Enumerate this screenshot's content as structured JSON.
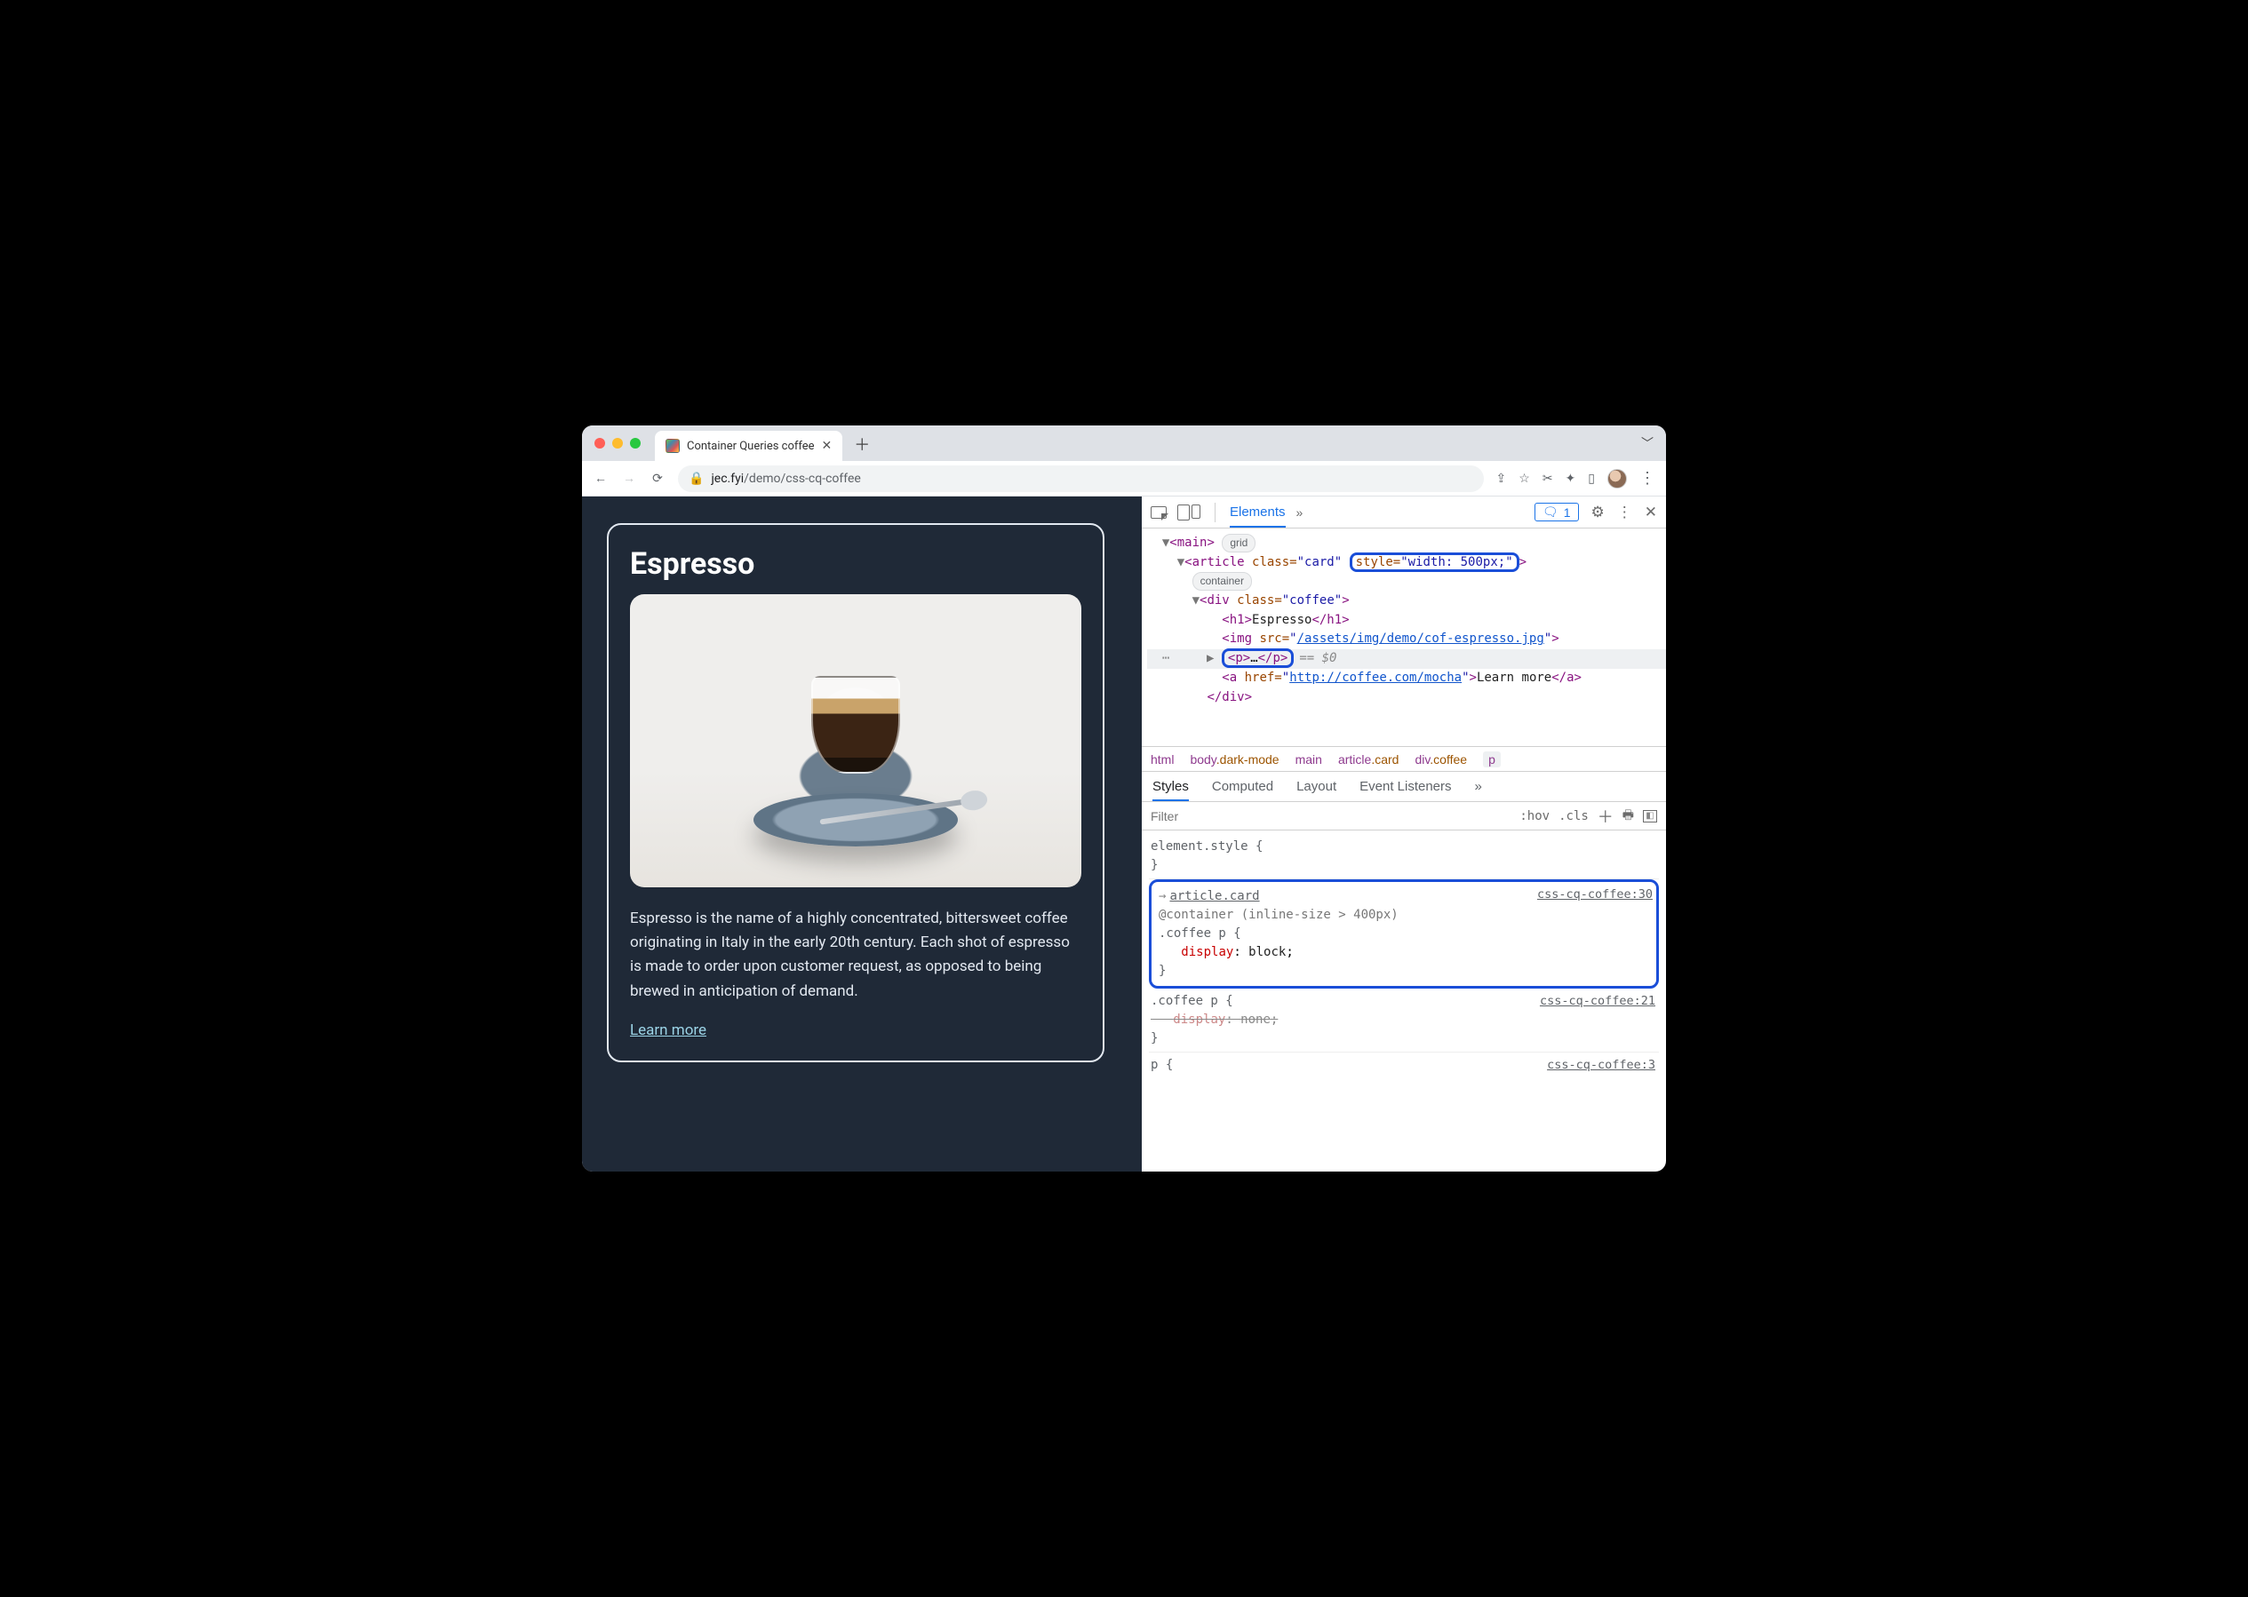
{
  "window": {
    "tab_title": "Container Queries coffee",
    "url_domain": "jec.fyi",
    "url_path": "/demo/css-cq-coffee"
  },
  "page": {
    "card_title": "Espresso",
    "card_paragraph": "Espresso is the name of a highly concentrated, bittersweet coffee originating in Italy in the early 20th century. Each shot of espresso is made to order upon customer request, as opposed to being brewed in anticipation of demand.",
    "learn_more": "Learn more"
  },
  "devtools": {
    "tabs": {
      "elements": "Elements"
    },
    "issues_count": "1",
    "dom": {
      "main_open": "<main>",
      "badge_grid": "grid",
      "article_open_pre": "<article ",
      "article_class_attr": "class=",
      "article_class_val": "\"card\"",
      "article_style": "style=\"width: 500px;\"",
      "article_close": ">",
      "badge_container": "container",
      "div_open": "<div class=\"coffee\">",
      "h1": "<h1>Espresso</h1>",
      "img_pre": "<img src=\"",
      "img_link": "/assets/img/demo/cof-espresso.jpg",
      "img_post": "\">",
      "p_collapsed": "<p>…</p>",
      "eq0": "== $0",
      "a_pre": "<a href=\"",
      "a_link": "http://coffee.com/mocha",
      "a_mid": "\">Learn more</a>",
      "div_close": "</div>"
    },
    "breadcrumb": {
      "html": "html",
      "body": "body.dark-mode",
      "main": "main",
      "article": "article.card",
      "div": "div.coffee",
      "p": "p"
    },
    "styles_tabs": {
      "styles": "Styles",
      "computed": "Computed",
      "layout": "Layout",
      "listeners": "Event Listeners"
    },
    "filter_placeholder": "Filter",
    "hov": ":hov",
    "cls": ".cls",
    "rules": {
      "elstyle": "element.style {",
      "close": "}",
      "r1_selector_link": "article.card",
      "r1_container": "@container (inline-size > 400px)",
      "r1_sel": ".coffee p {",
      "r1_prop": "display",
      "r1_val": "block",
      "r1_src": "css-cq-coffee:30",
      "r2_sel": ".coffee p {",
      "r2_prop": "display",
      "r2_val": "none",
      "r2_src": "css-cq-coffee:21",
      "r3_sel": "p {",
      "r3_src": "css-cq-coffee:3"
    }
  }
}
